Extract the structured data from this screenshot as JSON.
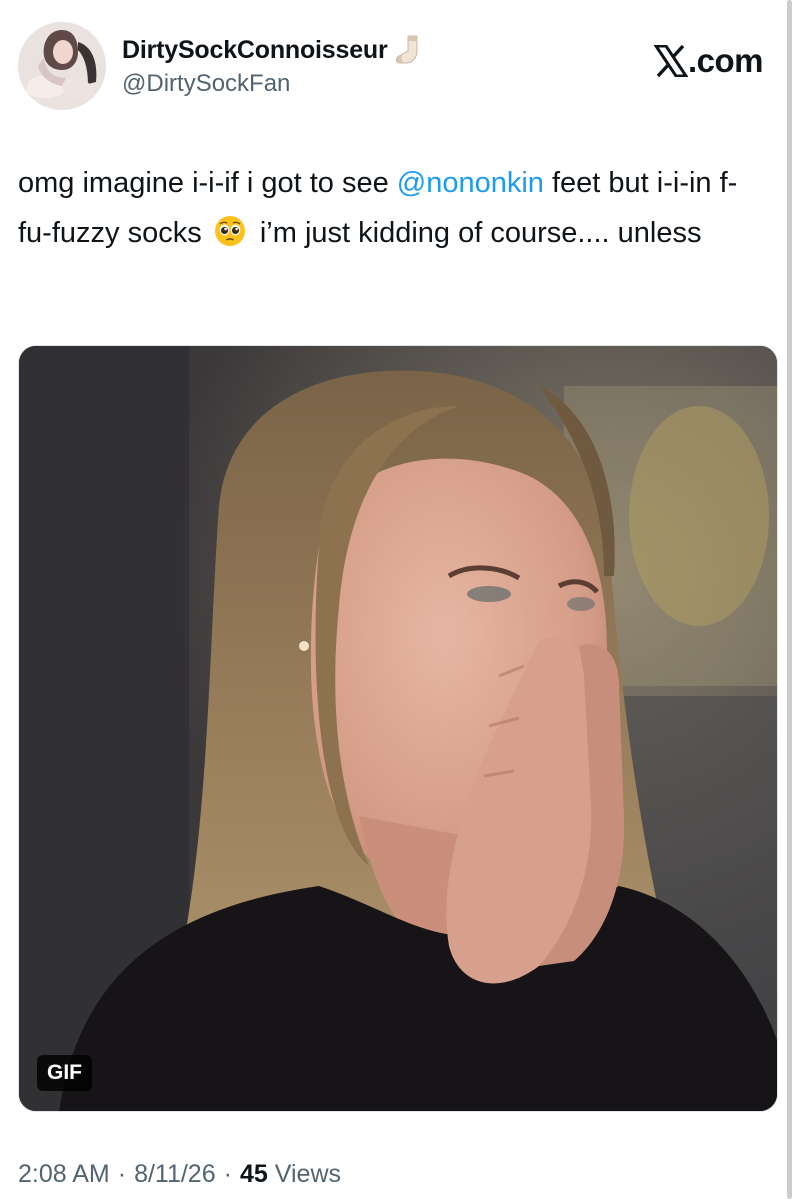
{
  "author": {
    "display_name": "DirtySockConnoisseur",
    "handle": "@DirtySockFan",
    "name_emoji": "sock-icon",
    "avatar": "avatar-image"
  },
  "brand": {
    "logo": "x-logo-icon",
    "text": ".com"
  },
  "tweet": {
    "text_part1": "omg imagine i-i-if i got to see ",
    "mention": "@nononkin",
    "text_part2": " feet but i-i-in f-fu-fuzzy socks ",
    "emoji": "pleading-face-icon",
    "text_part3": " i’m just kidding of course.... unless"
  },
  "media": {
    "type": "gif",
    "badge_label": "GIF"
  },
  "meta": {
    "time": "2:08 AM",
    "separator": "·",
    "date": "8/11/26",
    "views_count": "45",
    "views_label": "Views"
  },
  "colors": {
    "text": "#0f1419",
    "secondary": "#536471",
    "mention": "#1d9bf0",
    "background": "#ffffff"
  }
}
